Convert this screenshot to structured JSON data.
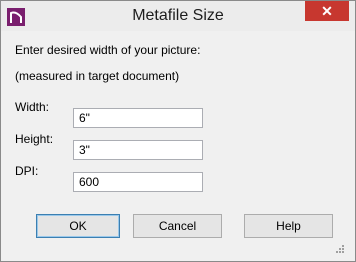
{
  "window": {
    "title": "Metafile Size",
    "close_glyph": "✕",
    "close_color": "#c7372f"
  },
  "instructions": {
    "line1": "Enter desired width of your picture:",
    "line2": "(measured in target document)"
  },
  "fields": {
    "width": {
      "label": "Width:",
      "value": "6\""
    },
    "height": {
      "label": "Height:",
      "value": "3\""
    },
    "dpi": {
      "label": "DPI:",
      "value": "600"
    }
  },
  "buttons": {
    "ok": "OK",
    "cancel": "Cancel",
    "help": "Help"
  },
  "icons": {
    "app": "app-logo-icon",
    "grip": "resize-grip-icon"
  }
}
